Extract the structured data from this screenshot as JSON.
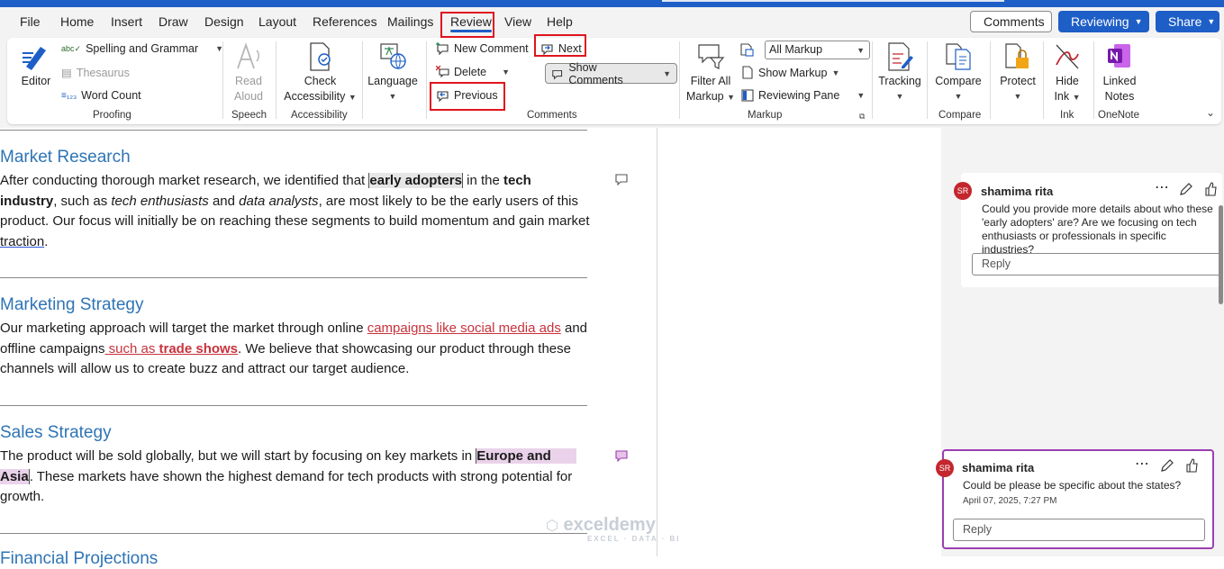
{
  "tabs": [
    "File",
    "Home",
    "Insert",
    "Draw",
    "Design",
    "Layout",
    "References",
    "Mailings",
    "Review",
    "View",
    "Help"
  ],
  "active_tab": "Review",
  "top_buttons": {
    "comments": "Comments",
    "reviewing": "Reviewing",
    "share": "Share"
  },
  "ribbon": {
    "proofing": {
      "editor": "Editor",
      "spelling": "Spelling and Grammar",
      "thesaurus": "Thesaurus",
      "word_count": "Word Count",
      "label": "Proofing"
    },
    "speech": {
      "read_aloud_1": "Read",
      "read_aloud_2": "Aloud",
      "label": "Speech"
    },
    "accessibility": {
      "check_1": "Check",
      "check_2": "Accessibility",
      "label": "Accessibility"
    },
    "language": {
      "btn": "Language"
    },
    "comments": {
      "new_comment": "New Comment",
      "next": "Next",
      "delete": "Delete",
      "show_comments": "Show Comments",
      "previous": "Previous",
      "label": "Comments"
    },
    "markup": {
      "filter_1": "Filter All",
      "filter_2": "Markup",
      "all_markup": "All Markup",
      "show_markup": "Show Markup",
      "reviewing_pane": "Reviewing Pane",
      "label": "Markup"
    },
    "tracking": {
      "btn": "Tracking"
    },
    "compare": {
      "btn": "Compare",
      "label": "Compare"
    },
    "protect": {
      "btn": "Protect"
    },
    "ink": {
      "hide_1": "Hide",
      "hide_2": "Ink",
      "label": "Ink"
    },
    "onenote": {
      "linked_1": "Linked",
      "linked_2": "Notes",
      "label": "OneNote"
    }
  },
  "document": {
    "h1": "Market Research",
    "p1": {
      "a": "After conducting thorough market research, we identified that ",
      "hl": "early adopters",
      "b": " in the ",
      "tech": "tech",
      "industry": "industry",
      "c": ", such as ",
      "i1": "tech enthusiasts",
      "d": " and ",
      "i2": "data analysts",
      "e": ", are most likely to be the early users of this product. Our focus will initially be on reaching these segments to build momentum and gain market ",
      "traction": "traction",
      "f": "."
    },
    "h2": "Marketing Strategy",
    "p2": {
      "a": "Our marketing approach will target the market through online ",
      "ins1": "campaigns like social media ads",
      "b": " and offline campaigns",
      "ins2a": " such as ",
      "ins2b": "trade shows",
      "c": ". We believe that showcasing our product through these channels will allow us to create buzz and attract our target audience."
    },
    "h3": "Sales Strategy",
    "p3": {
      "a": "The product will be sold globally, but we will start by focusing on key markets in ",
      "hl1": "Europe and",
      "hl2": "Asia",
      "b": ". These markets have shown the highest demand for tech products with strong potential for growth."
    },
    "h4": "Financial Projections"
  },
  "comments": [
    {
      "initials": "SR",
      "author": "shamima rita",
      "text": "Could you provide more details about who these 'early adopters' are? Are we focusing on tech enthusiasts or professionals in specific industries?",
      "reply_placeholder": "Reply"
    },
    {
      "initials": "SR",
      "author": "shamima rita",
      "text": "Could be please be specific about the states?",
      "date": "April 07, 2025, 7:27 PM",
      "reply_placeholder": "Reply"
    }
  ],
  "watermark": {
    "name": "exceldemy",
    "tagline": "EXCEL · DATA · BI"
  },
  "colors": {
    "accent": "#1e5ec7",
    "heading": "#2e74b5",
    "highlight_box": "#e0141e",
    "active_comment_border": "#9b3fb0",
    "insert_red": "#c8323c"
  }
}
